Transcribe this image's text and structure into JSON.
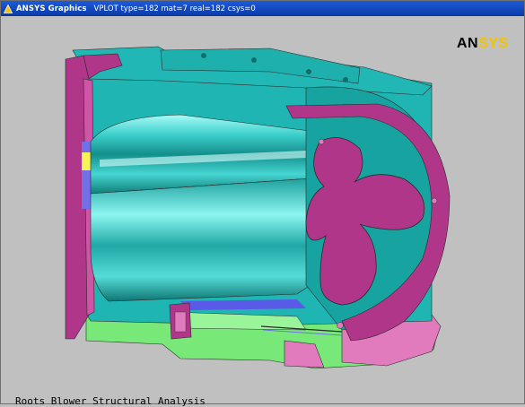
{
  "window": {
    "title": "ANSYS Graphics",
    "plot_info": "VPLOT  type=182 mat=7 real=182 csys=0"
  },
  "logo": {
    "part1": "AN",
    "part2": "SYS"
  },
  "caption": "Roots Blower Structural Analysis",
  "colors": {
    "background": "#c0c0c0",
    "titlebar": "#0b3aa7",
    "teal": "#1fb5b2",
    "magenta": "#b0368a",
    "green": "#78e878",
    "logo_yellow": "#f5c400"
  }
}
